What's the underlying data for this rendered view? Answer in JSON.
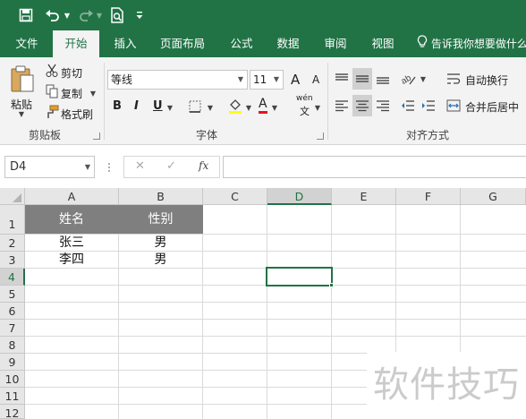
{
  "qat": {
    "icons": [
      "save-icon",
      "undo-icon",
      "redo-icon",
      "print-preview-icon",
      "customize-icon"
    ]
  },
  "tabs": [
    "文件",
    "开始",
    "插入",
    "页面布局",
    "公式",
    "数据",
    "审阅",
    "视图"
  ],
  "active_tab": "开始",
  "tell_me": "告诉我你想要做什么",
  "ribbon": {
    "clipboard": {
      "paste": "粘贴",
      "cut": "剪切",
      "copy": "复制",
      "format_painter": "格式刷",
      "group": "剪贴板"
    },
    "font": {
      "name": "等线",
      "size": "11",
      "bold": "B",
      "italic": "I",
      "underline": "U",
      "grow": "A",
      "shrink": "A",
      "color_a": "A",
      "phonetic_top": "wén",
      "phonetic_bottom": "文",
      "group": "字体"
    },
    "alignment": {
      "wrap": "自动换行",
      "merge": "合并后居中",
      "group": "对齐方式"
    }
  },
  "formula_bar": {
    "name_box": "D4",
    "cancel": "✕",
    "enter": "✓",
    "fx": "fx",
    "value": ""
  },
  "columns": [
    "A",
    "B",
    "C",
    "D",
    "E",
    "F",
    "G"
  ],
  "rows": [
    "1",
    "2",
    "3",
    "4",
    "5",
    "6",
    "7",
    "8",
    "9",
    "10",
    "11",
    "12"
  ],
  "selected_column": "D",
  "selected_row": "4",
  "cells": {
    "A1": "姓名",
    "B1": "性别",
    "A2": "张三",
    "B2": "男",
    "A3": "李四",
    "B3": "男"
  },
  "watermark": "软件技巧",
  "colors": {
    "excel_green": "#217346",
    "header_fill": "#7f7f7f"
  }
}
